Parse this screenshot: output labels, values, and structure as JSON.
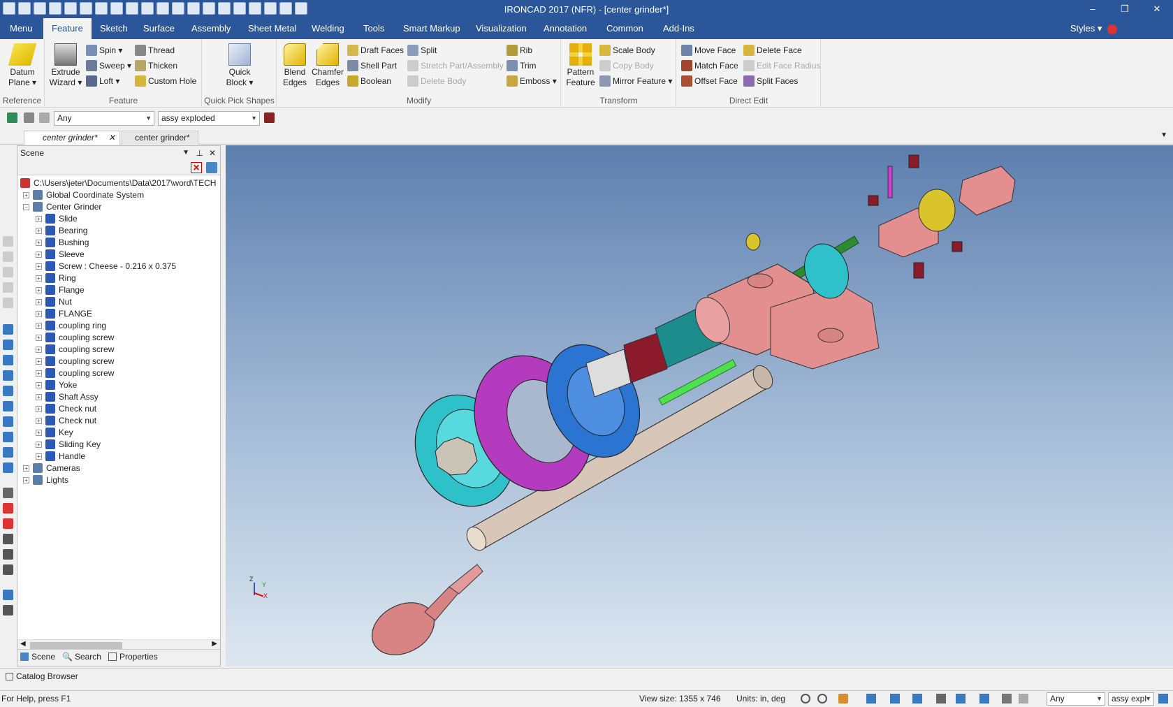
{
  "window": {
    "title": "IRONCAD 2017 (NFR) - [center grinder*]",
    "minimize": "–",
    "restore": "❐",
    "close": "✕"
  },
  "ribbon_tabs": [
    "Menu",
    "Feature",
    "Sketch",
    "Surface",
    "Assembly",
    "Sheet Metal",
    "Welding",
    "Tools",
    "Smart Markup",
    "Visualization",
    "Annotation",
    "Common",
    "Add-Ins"
  ],
  "styles_label": "Styles",
  "groups": {
    "reference": {
      "name": "Reference",
      "datum_plane": "Datum Plane"
    },
    "feature": {
      "name": "Feature",
      "extrude_wizard": "Extrude Wizard",
      "spin": "Spin",
      "sweep": "Sweep",
      "loft": "Loft",
      "thread": "Thread",
      "thicken": "Thicken",
      "custom_hole": "Custom Hole"
    },
    "quick_pick": {
      "name": "Quick Pick Shapes",
      "quick_block": "Quick Block"
    },
    "modify": {
      "name": "Modify",
      "blend_edges": "Blend Edges",
      "chamfer_edges": "Chamfer Edges",
      "draft_faces": "Draft Faces",
      "shell_part": "Shell Part",
      "boolean": "Boolean",
      "split": "Split",
      "stretch": "Stretch Part/Assembly",
      "delete_body": "Delete Body",
      "rib": "Rib",
      "trim": "Trim",
      "emboss": "Emboss"
    },
    "transform": {
      "name": "Transform",
      "pattern_feature": "Pattern Feature",
      "scale_body": "Scale Body",
      "copy_body": "Copy Body",
      "mirror_feature": "Mirror Feature"
    },
    "direct_edit": {
      "name": "Direct Edit",
      "move_face": "Move Face",
      "match_face": "Match Face",
      "offset_face": "Offset Face",
      "delete_face": "Delete Face",
      "edit_face_radius": "Edit Face Radius",
      "split_faces": "Split Faces"
    }
  },
  "toolbar": {
    "filter_value": "Any",
    "config_value": "assy exploded"
  },
  "doc_tabs": [
    "center grinder*",
    "center grinder*"
  ],
  "scene": {
    "title": "Scene",
    "root_path": "C:\\Users\\jeter\\Documents\\Data\\2017\\word\\TECH",
    "items": [
      "Global Coordinate System",
      "Center Grinder",
      "Slide",
      "Bearing",
      "Bushing",
      "Sleeve",
      "Screw : Cheese - 0.216 x 0.375",
      "Ring",
      "Flange",
      "Nut",
      "FLANGE",
      "coupling ring",
      "coupling screw",
      "coupling screw",
      "coupling screw",
      "coupling screw",
      "Yoke",
      "Shaft Assy",
      "Check nut",
      "Check nut",
      "Key",
      "Sliding Key",
      "Handle",
      "Cameras",
      "Lights"
    ]
  },
  "panel_tabs": [
    "Scene",
    "Search",
    "Properties"
  ],
  "catalog_label": "Catalog Browser",
  "status": {
    "help": "For Help, press F1",
    "view_size": "View size: 1355 x  746",
    "units": "Units: in, deg",
    "filter": "Any",
    "config": "assy expl"
  },
  "triad": {
    "z": "Z",
    "y": "Y",
    "x": "X"
  },
  "colors": {
    "title_bar": "#2b579a",
    "accent": "#2b579a",
    "viewport_top": "#5d7fae",
    "viewport_bottom": "#dde7f0"
  }
}
